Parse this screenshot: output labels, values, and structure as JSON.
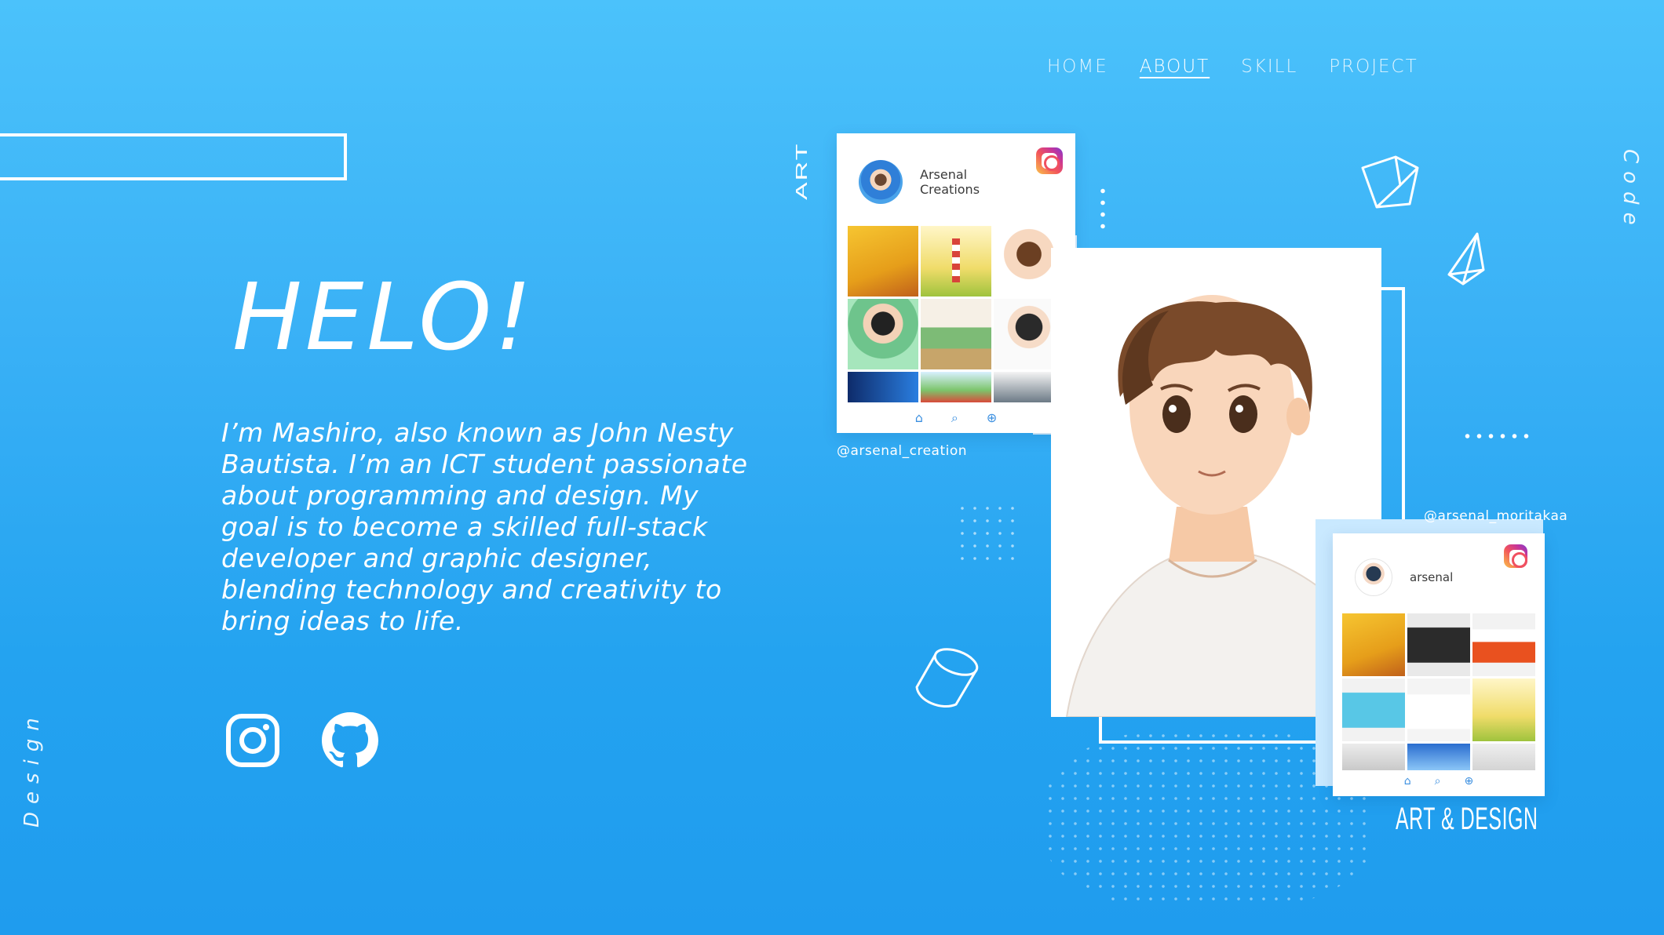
{
  "nav": {
    "items": [
      {
        "label": "HOME",
        "active": false
      },
      {
        "label": "ABOUT",
        "active": true
      },
      {
        "label": "SKILL",
        "active": false
      },
      {
        "label": "PROJECT",
        "active": false
      }
    ]
  },
  "hero": {
    "title": "HELO!",
    "description": "I’m Mashiro, also known as John Nesty Bautista. I’m an ICT student passionate about programming and design. My goal is to become a skilled full-stack developer and graphic designer, blending technology and creativity to bring ideas to life."
  },
  "social": {
    "instagram_icon": "instagram-icon",
    "github_icon": "github-icon"
  },
  "side_labels": {
    "design": "Design",
    "code": "Code",
    "art": "ART",
    "art_design": "ART & DESIGN"
  },
  "cards": {
    "art": {
      "name": "Arsenal Creations",
      "handle": "@arsenal_creation"
    },
    "design": {
      "name": "arsenal",
      "handle": "@arsenal_moritakaa"
    }
  },
  "colors": {
    "bg_top": "#4bc2fb",
    "bg_bottom": "#1f9cee",
    "accent": "#ffffff"
  }
}
